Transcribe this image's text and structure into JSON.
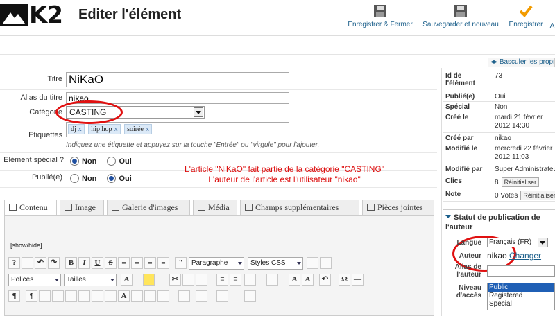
{
  "header": {
    "logo_text": "K2",
    "title": "Editer l'élément",
    "toolbar": [
      {
        "label": "Enregistrer & Fermer",
        "icon": "floppy-icon"
      },
      {
        "label": "Sauvegarder et nouveau",
        "icon": "floppy-icon"
      },
      {
        "label": "Enregistrer",
        "icon": "checkmark-icon"
      },
      {
        "label": "A",
        "icon": ""
      }
    ]
  },
  "form": {
    "title_label": "Titre",
    "title_value": "NiKaO",
    "alias_label": "Alias du titre",
    "alias_value": "nikao",
    "category_label": "Catégorie",
    "category_value": "CASTING",
    "tags_label": "Etiquettes",
    "tags": [
      "dj",
      "hip hop",
      "soirée"
    ],
    "tag_remove": "x",
    "tags_hint": "Indiquez une étiquette et appuyez sur la touche \"Entrée\" ou \"virgule\" pour l'ajouter.",
    "special_label": "Elément spécial ?",
    "published_label": "Publié(e)",
    "option_no": "Non",
    "option_yes": "Oui",
    "special_value": "Non",
    "published_value": "Oui",
    "note_line1": "L'article \"NiKaO\" fait partie de la catégorie \"CASTING\"",
    "note_line2": "L'auteur de l'article est l'utilisateur \"nikao\"",
    "annotation_color": "#e01010"
  },
  "tabs": [
    {
      "label": "Contenu",
      "icon": "document-icon",
      "active": true
    },
    {
      "label": "Image",
      "icon": "image-icon",
      "active": false
    },
    {
      "label": "Galerie d'images",
      "icon": "gallery-icon",
      "active": false
    },
    {
      "label": "Média",
      "icon": "film-icon",
      "active": false
    },
    {
      "label": "Champs supplémentaires",
      "icon": "fields-icon",
      "active": false
    },
    {
      "label": "Pièces jointes",
      "icon": "paperclip-icon",
      "active": false
    }
  ],
  "editor": {
    "show_hide": "[show/hide]",
    "format_select": "Paragraphe",
    "styles_select": "Styles CSS",
    "font_select": "Polices",
    "size_select": "Tailles",
    "bold": "B",
    "italic": "I",
    "underline": "U",
    "strike": "S"
  },
  "sidebar": {
    "toggle_link": "Basculer les propriétés",
    "info": [
      {
        "key": "Id de l'élément",
        "value": "73"
      },
      {
        "key": "Publié(e)",
        "value": "Oui"
      },
      {
        "key": "Spécial",
        "value": "Non"
      },
      {
        "key": "Créé le",
        "value": "mardi 21 février 2012 14:30"
      },
      {
        "key": "Créé par",
        "value": "nikao"
      },
      {
        "key": "Modifié le",
        "value": "mercredi 22 février 2012 11:03"
      },
      {
        "key": "Modifié par",
        "value": "Super Administrateur"
      },
      {
        "key": "Clics",
        "value": "8"
      },
      {
        "key": "Note",
        "value": "0 Votes"
      }
    ],
    "reset_label": "Réinitialiser",
    "author_panel": {
      "title": "Statut de publication de l'auteur",
      "language_label": "Langue",
      "language_value": "Français (FR)",
      "author_label": "Auteur",
      "author_value": "nikao",
      "change_link": "Changer",
      "alias_label": "Alias de l'auteur",
      "access_label": "Niveau d'accès",
      "access_options": [
        "Public",
        "Registered",
        "Special"
      ],
      "access_selected": "Public"
    }
  }
}
